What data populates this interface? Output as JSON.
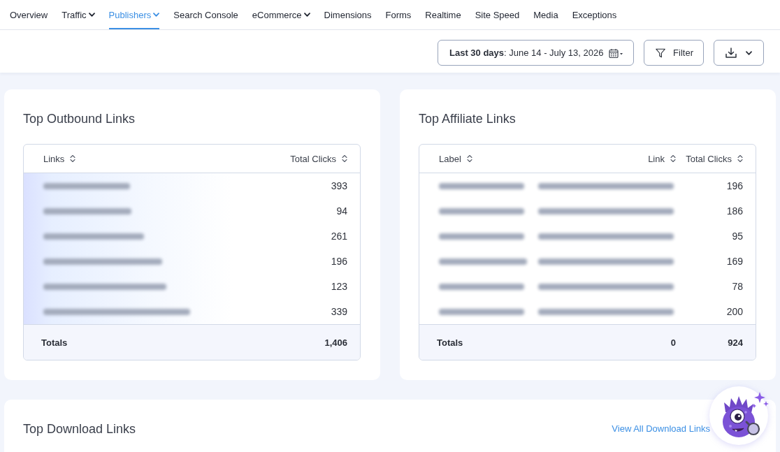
{
  "nav": {
    "items": [
      {
        "label": "Overview",
        "selected": false,
        "dropdown": false
      },
      {
        "label": "Traffic",
        "selected": false,
        "dropdown": true
      },
      {
        "label": "Publishers",
        "selected": true,
        "dropdown": true
      },
      {
        "label": "Search Console",
        "selected": false,
        "dropdown": false
      },
      {
        "label": "eCommerce",
        "selected": false,
        "dropdown": true
      },
      {
        "label": "Dimensions",
        "selected": false,
        "dropdown": false
      },
      {
        "label": "Forms",
        "selected": false,
        "dropdown": false
      },
      {
        "label": "Realtime",
        "selected": false,
        "dropdown": false
      },
      {
        "label": "Site Speed",
        "selected": false,
        "dropdown": false
      },
      {
        "label": "Media",
        "selected": false,
        "dropdown": false
      },
      {
        "label": "Exceptions",
        "selected": false,
        "dropdown": false
      }
    ]
  },
  "toolbar": {
    "date_range": "**Last 30 days**: June 14 - July 13, 2026",
    "filter": "Filter"
  },
  "cards": [
    {
      "title": "Top Outbound Links",
      "table": {
        "columns": [
          {
            "label": "Links",
            "kind": "label"
          },
          {
            "label": "Total Clicks",
            "kind": "count"
          }
        ],
        "rows": [
          {
            "cells": [
              {
                "kind": "blurred"
              },
              {
                "kind": "value",
                "text": "393"
              }
            ]
          },
          {
            "cells": [
              {
                "kind": "blurred"
              },
              {
                "kind": "value",
                "text": "94"
              }
            ]
          },
          {
            "cells": [
              {
                "kind": "blurred"
              },
              {
                "kind": "value",
                "text": "261"
              }
            ]
          },
          {
            "cells": [
              {
                "kind": "blurred"
              },
              {
                "kind": "value",
                "text": "196"
              }
            ]
          },
          {
            "cells": [
              {
                "kind": "blurred"
              },
              {
                "kind": "value",
                "text": "123"
              }
            ]
          },
          {
            "cells": [
              {
                "kind": "blurred"
              },
              {
                "kind": "value",
                "text": "339"
              }
            ]
          }
        ],
        "totals": [
          {
            "text": "Totals"
          },
          {
            "text": "1,406"
          }
        ]
      }
    },
    {
      "title": "Top Affiliate Links",
      "table": {
        "columns": [
          {
            "label": "Label",
            "kind": "label"
          },
          {
            "label": "Link",
            "kind": "link"
          },
          {
            "label": "Total Clicks",
            "kind": "count"
          }
        ],
        "rows": [
          {
            "cells": [
              {
                "kind": "blurred"
              },
              {
                "kind": "blurred"
              },
              {
                "kind": "value",
                "text": "196"
              }
            ]
          },
          {
            "cells": [
              {
                "kind": "blurred"
              },
              {
                "kind": "blurred"
              },
              {
                "kind": "value",
                "text": "186"
              }
            ]
          },
          {
            "cells": [
              {
                "kind": "blurred"
              },
              {
                "kind": "blurred"
              },
              {
                "kind": "value",
                "text": "95"
              }
            ]
          },
          {
            "cells": [
              {
                "kind": "blurred"
              },
              {
                "kind": "blurred"
              },
              {
                "kind": "value",
                "text": "169"
              }
            ]
          },
          {
            "cells": [
              {
                "kind": "blurred"
              },
              {
                "kind": "blurred"
              },
              {
                "kind": "value",
                "text": "78"
              }
            ]
          },
          {
            "cells": [
              {
                "kind": "blurred"
              },
              {
                "kind": "blurred"
              },
              {
                "kind": "value",
                "text": "200"
              }
            ]
          }
        ],
        "totals": [
          {
            "text": "Totals"
          },
          {
            "text": "0"
          },
          {
            "text": "924"
          }
        ]
      }
    }
  ],
  "download_links": {
    "title": "Top Download Links",
    "view_all": "View All Download Links"
  }
}
